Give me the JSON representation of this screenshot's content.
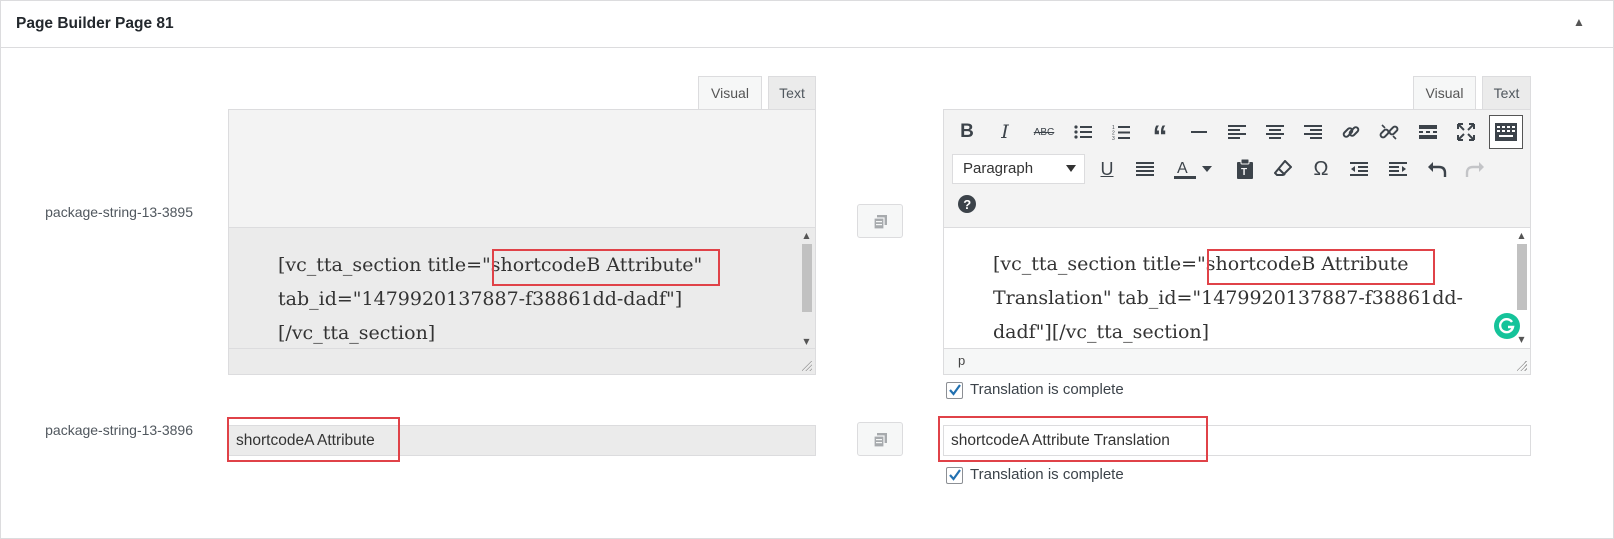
{
  "panel": {
    "title": "Page Builder Page 81"
  },
  "rows": [
    {
      "label": "package-string-13-3895"
    },
    {
      "label": "package-string-13-3896"
    }
  ],
  "editor_tabs": {
    "visual": "Visual",
    "text": "Text"
  },
  "source_editor": {
    "content": "[vc_tta_section title=\"shortcodeB Attribute\" tab_id=\"1479920137887-f38861dd-dadf\"][/vc_tta_section]"
  },
  "translation_editor": {
    "content": "[vc_tta_section title=\"shortcodeB Attribute Translation\" tab_id=\"1479920137887-f38861dd-dadf\"][/vc_tta_section]",
    "format_select": "Paragraph",
    "status_path": "p",
    "toolbar_icons": [
      "bold-icon",
      "italic-icon",
      "strikethrough-icon",
      "bullet-list-icon",
      "numbered-list-icon",
      "blockquote-icon",
      "horizontal-line-icon",
      "align-left-icon",
      "align-center-icon",
      "align-right-icon",
      "link-icon",
      "unlink-icon",
      "read-more-icon",
      "fullscreen-icon",
      "toolbar-toggle-icon",
      "underline-icon",
      "justify-icon",
      "text-color-icon",
      "paste-text-icon",
      "clear-format-icon",
      "special-char-icon",
      "outdent-icon",
      "indent-icon",
      "undo-icon",
      "redo-icon",
      "help-icon"
    ]
  },
  "source_input": {
    "value": "shortcodeA Attribute"
  },
  "translation_input": {
    "value": "shortcodeA Attribute Translation"
  },
  "complete_label": "Translation is complete",
  "colors": {
    "highlight": "#e04248",
    "checkbox": "#2271b1",
    "grammarly": "#15c39a"
  }
}
